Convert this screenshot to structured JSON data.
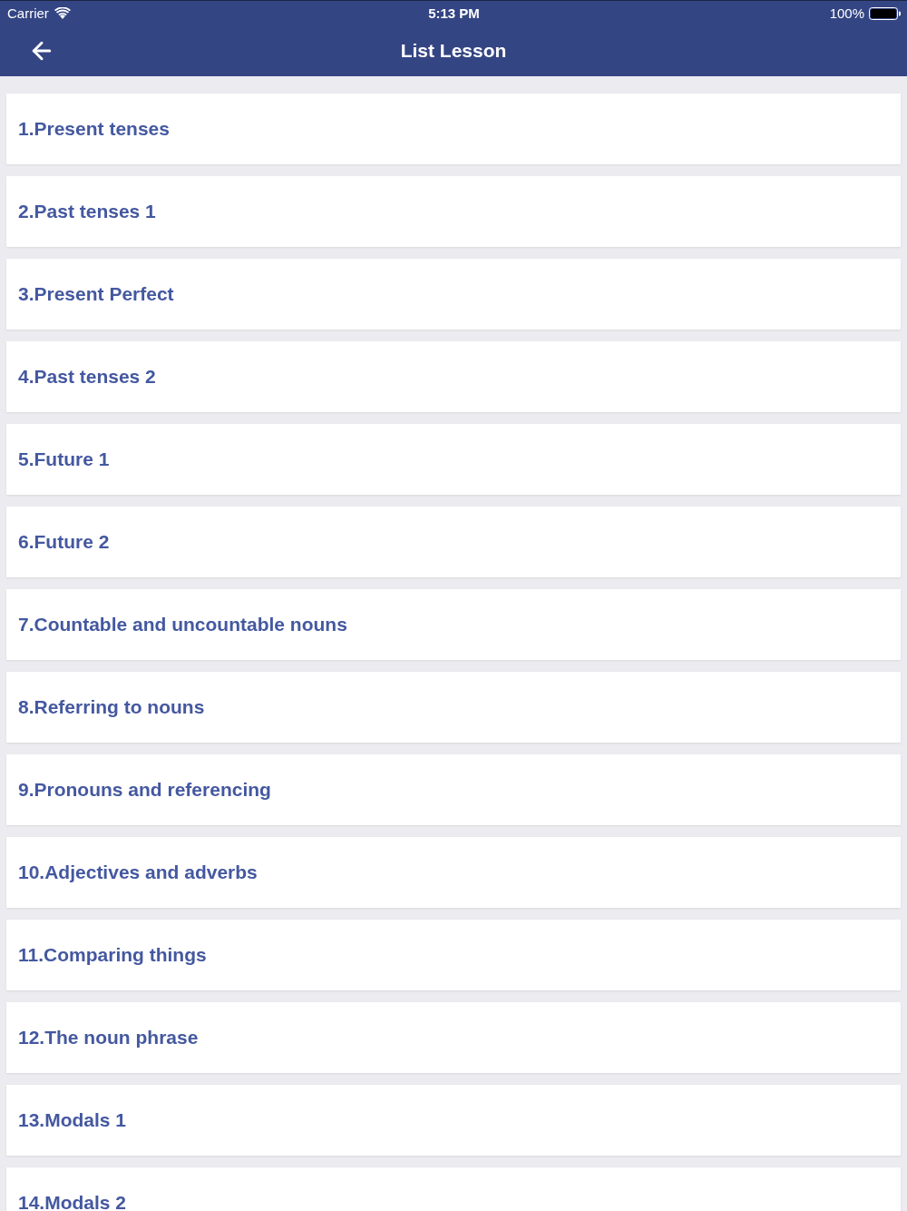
{
  "status_bar": {
    "carrier": "Carrier",
    "time": "5:13 PM",
    "battery": "100%"
  },
  "nav_bar": {
    "title": "List Lesson"
  },
  "lessons": [
    "1.Present tenses",
    "2.Past tenses 1",
    "3.Present Perfect",
    "4.Past tenses 2",
    "5.Future 1",
    "6.Future 2",
    "7.Countable and uncountable nouns",
    "8.Referring to nouns",
    "9.Pronouns and referencing",
    "10.Adjectives and adverbs",
    "11.Comparing things",
    "12.The noun phrase",
    "13.Modals 1",
    "14.Modals 2"
  ]
}
